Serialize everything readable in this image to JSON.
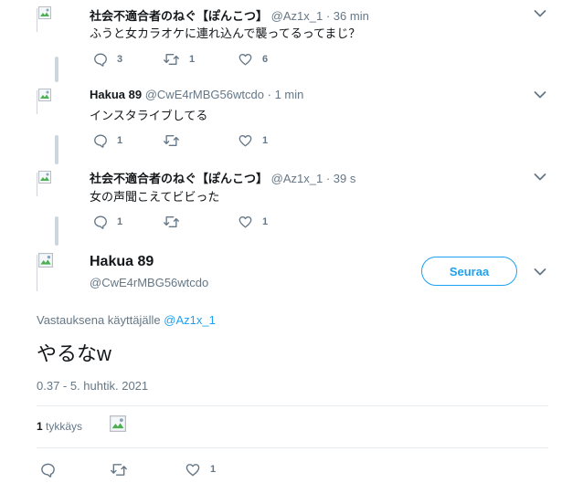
{
  "tweets": [
    {
      "name": "社会不適合者のねぐ【ぽんこつ】",
      "handle": "@Az1x_1",
      "dot": "·",
      "time": "36 min",
      "text": "ふうと女カラオケに連れ込んで襲ってるってまじ？",
      "replies": "3",
      "retweets": "1",
      "likes": "6"
    },
    {
      "name": "Hakua 89",
      "handle": "@CwE4rMBG56wtcdo",
      "dot": "·",
      "time": "1 min",
      "text": "インスタライブしてる",
      "replies": "1",
      "retweets": "",
      "likes": "1"
    },
    {
      "name": "社会不適合者のねぐ【ぽんこつ】",
      "handle": "@Az1x_1",
      "dot": "·",
      "time": "39 s",
      "text": "女の声聞こえてビビった",
      "replies": "1",
      "retweets": "",
      "likes": "1"
    }
  ],
  "main": {
    "name": "Hakua 89",
    "handle": "@CwE4rMBG56wtcdo",
    "follow_label": "Seuraa",
    "reply_prefix": "Vastauksena käyttäjälle",
    "reply_mention": "@Az1x_1",
    "text": "やるなw",
    "timestamp": "0.37 - 5. huhtik. 2021",
    "likes_count": "1",
    "likes_label": "tykkäys",
    "replies": "",
    "retweets": "",
    "likes": "1"
  },
  "colors": {
    "accent": "#1da1f2",
    "secondary_text": "#657786",
    "thread_line": "#ccd6dd"
  },
  "icons": [
    "reply-icon",
    "retweet-icon",
    "like-icon",
    "chevron-down-icon",
    "broken-image-icon"
  ]
}
